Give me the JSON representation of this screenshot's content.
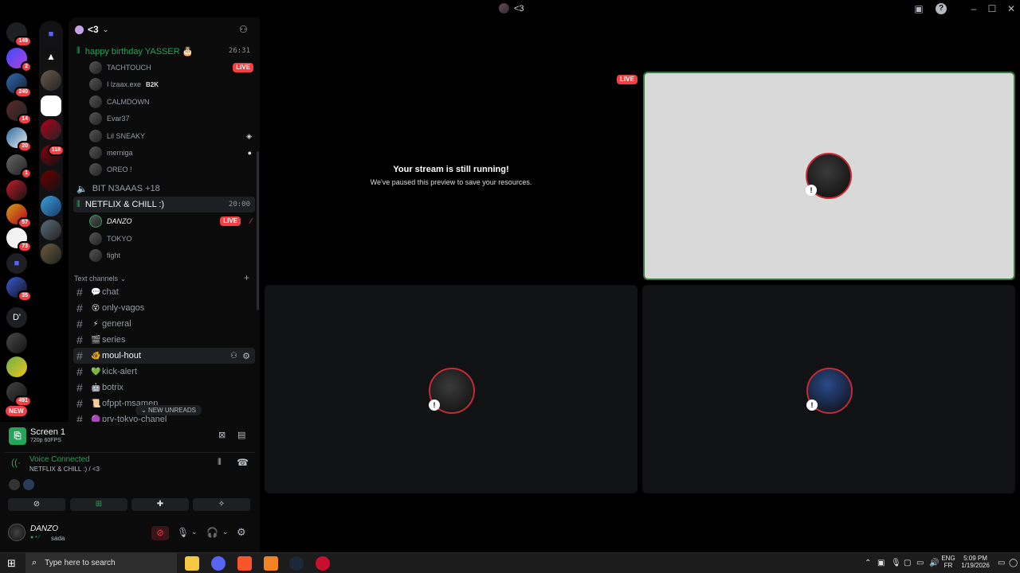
{
  "titlebar": {
    "title": "<3"
  },
  "guild_badges": [
    "149",
    "2",
    "240",
    "14",
    "20",
    "1",
    "57",
    "73",
    "35",
    "491",
    "NEW"
  ],
  "folder_badges": [
    "118"
  ],
  "dm_letter": "D'",
  "server": {
    "name": "<3"
  },
  "voice_channels": [
    {
      "name": "happy birthday YASSER 🎂",
      "time": "26:31",
      "active": true
    },
    {
      "name": "BIT N3AAAS +18",
      "active": false
    },
    {
      "name": "NETFLIX & CHILL :)",
      "time": "20:00",
      "active": true
    }
  ],
  "users_birthday": [
    {
      "name": "TACHTOUCH",
      "live": "LIVE"
    },
    {
      "name": "I lzaax.exe",
      "tag": "B2K"
    },
    {
      "name": "CALMDOWN"
    },
    {
      "name": "Evar37"
    },
    {
      "name": "Lil SNEAKY"
    },
    {
      "name": "merniga"
    },
    {
      "name": "OREO !"
    }
  ],
  "users_netflix": [
    {
      "name": "DANZO",
      "live": "LIVE"
    },
    {
      "name": "TOKYO"
    },
    {
      "name": "fight"
    }
  ],
  "text_section": "Text channels",
  "text_channels": [
    {
      "name": "chat",
      "emoji": "💬"
    },
    {
      "name": "only-vagos",
      "emoji": "😵"
    },
    {
      "name": "general",
      "emoji": "⚡"
    },
    {
      "name": "series",
      "emoji": "🎬"
    },
    {
      "name": "moul-hout",
      "emoji": "🐠"
    },
    {
      "name": "kick-alert",
      "emoji": "💚"
    },
    {
      "name": "botrix",
      "emoji": "🤖"
    },
    {
      "name": "ofppt-msamen",
      "emoji": "📜"
    },
    {
      "name": "prv-tokyo-chanel",
      "emoji": "🟣"
    }
  ],
  "new_unreads": "NEW UNREADS",
  "stream_panel": {
    "title": "Screen 1",
    "quality": "720p 60FPS"
  },
  "voice_panel": {
    "status": "Voice Connected",
    "location": "NETFLIX & CHILL :) / <3"
  },
  "user_panel": {
    "name": "DANZO",
    "status": "sada"
  },
  "main": {
    "paused_title": "Your stream is still running!",
    "paused_sub": "We've paused this preview to save your resources.",
    "live_label": "LIVE"
  },
  "taskbar": {
    "search_placeholder": "Type here to search",
    "lang_top": "ENG",
    "lang_bottom": "FR",
    "time": "5:09 PM",
    "date": "1/19/2026"
  },
  "colors": {
    "accent_green": "#23a55a",
    "live_red": "#f23f43",
    "bg": "#000000"
  }
}
